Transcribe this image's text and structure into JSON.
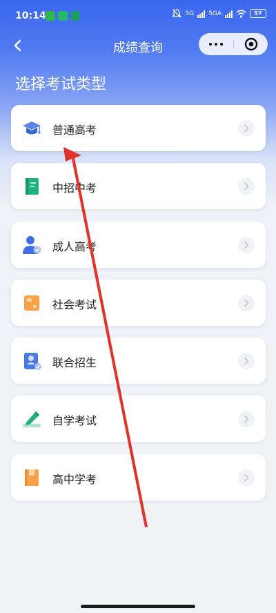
{
  "status_bar": {
    "time": "10:14",
    "net1": "5G",
    "net2": "5GA",
    "battery": "57",
    "apps": [
      {
        "name": "wechat-icon",
        "color": "#2fb84f"
      },
      {
        "name": "app-shield-icon",
        "color": "#25b86a"
      },
      {
        "name": "app-book-icon",
        "color": "#1e9a6b"
      }
    ]
  },
  "nav": {
    "title": "成绩查询"
  },
  "heading": "选择考试类型",
  "exam_types": [
    {
      "label": "普通高考",
      "icon": "graduation-cap-icon"
    },
    {
      "label": "中招中考",
      "icon": "green-book-icon"
    },
    {
      "label": "成人高考",
      "icon": "adult-person-icon"
    },
    {
      "label": "社会考试",
      "icon": "orange-certificate-icon"
    },
    {
      "label": "联合招生",
      "icon": "id-card-icon"
    },
    {
      "label": "自学考试",
      "icon": "pen-icon"
    },
    {
      "label": "高中学考",
      "icon": "orange-folder-icon"
    }
  ],
  "colors": {
    "accent": "#3a67ef",
    "annotation_arrow": "#e0342b"
  }
}
